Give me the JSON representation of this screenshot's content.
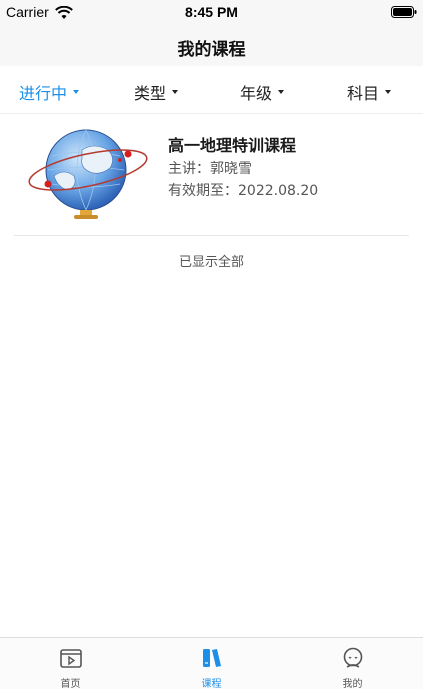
{
  "status_bar": {
    "carrier": "Carrier",
    "time": "8:45 PM"
  },
  "nav": {
    "title": "我的课程"
  },
  "filters": [
    {
      "label": "进行中",
      "active": true
    },
    {
      "label": "类型",
      "active": false
    },
    {
      "label": "年级",
      "active": false
    },
    {
      "label": "科目",
      "active": false
    }
  ],
  "courses": [
    {
      "title": "高一地理特训课程",
      "teacher": "主讲：郭晓雪",
      "expiry": "有效期至：2022.08.20",
      "thumbnail_icon": "globe-icon"
    }
  ],
  "list_footer": "已显示全部",
  "tabs": [
    {
      "label": "首页",
      "icon": "home-video-icon",
      "active": false
    },
    {
      "label": "课程",
      "icon": "books-icon",
      "active": true
    },
    {
      "label": "我的",
      "icon": "profile-icon",
      "active": false
    }
  ],
  "colors": {
    "accent": "#1e8fe8",
    "text": "#222222",
    "secondary_text": "#555555"
  }
}
